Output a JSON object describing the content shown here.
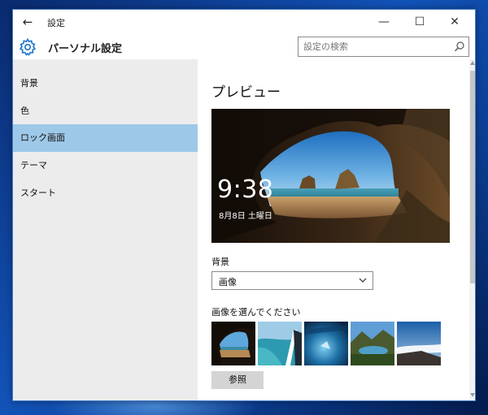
{
  "window": {
    "title": "設定",
    "heading": "パーソナル設定"
  },
  "titlebar_controls": {
    "back": "←",
    "minimize": "—",
    "maximize": "☐",
    "close": "✕"
  },
  "search": {
    "placeholder": "設定の検索"
  },
  "sidebar": {
    "items": [
      {
        "label": "背景"
      },
      {
        "label": "色"
      },
      {
        "label": "ロック画面",
        "selected": true
      },
      {
        "label": "テーマ"
      },
      {
        "label": "スタート"
      }
    ]
  },
  "main": {
    "title": "プレビュー",
    "preview": {
      "time": "9:38",
      "date": "8月8日 土曜日"
    },
    "background_label": "背景",
    "background_value": "画像",
    "choose_label": "画像を選んでください",
    "browse_label": "参照"
  },
  "colors": {
    "accent_selected": "#9ec8e7",
    "sidebar_bg": "#ececec"
  },
  "icons": {
    "settings": "gear-icon",
    "search": "search-icon",
    "dropdown": "chevron-down-icon"
  }
}
